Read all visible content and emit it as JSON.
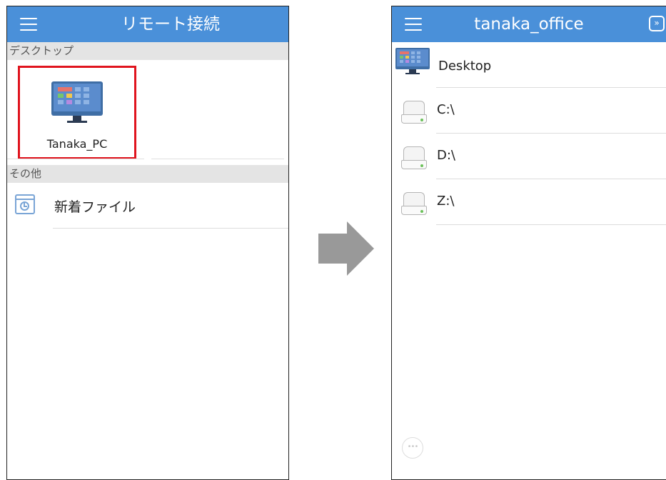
{
  "left": {
    "title": "リモート接続",
    "sections": {
      "desktop_header": "デスクトップ",
      "other_header": "その他"
    },
    "pc_tile": {
      "label": "Tanaka_PC"
    },
    "recent_files": "新着ファイル"
  },
  "right": {
    "title": "tanaka_office",
    "expand_glyph": "»",
    "items": [
      {
        "label": "Desktop",
        "icon": "desktop-icon"
      },
      {
        "label": "C:\\",
        "icon": "drive-icon"
      },
      {
        "label": "D:\\",
        "icon": "drive-icon"
      },
      {
        "label": "Z:\\",
        "icon": "drive-icon"
      }
    ],
    "more_glyph": "•••"
  },
  "colors": {
    "appbar": "#4a90d9",
    "highlight_border": "#e0141e",
    "arrow": "#999999"
  }
}
